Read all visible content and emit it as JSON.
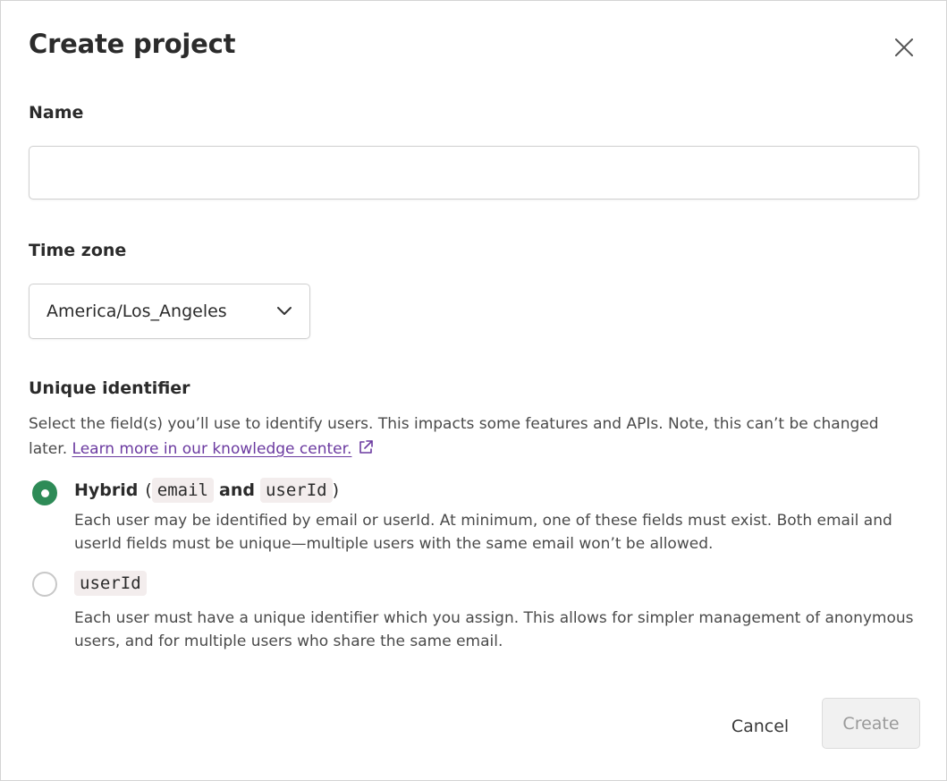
{
  "dialog": {
    "title": "Create project",
    "close_icon": "close-icon"
  },
  "name_field": {
    "label": "Name",
    "value": ""
  },
  "timezone": {
    "label": "Time zone",
    "selected": "America/Los_Angeles",
    "icon": "chevron-down-icon"
  },
  "unique_identifier": {
    "label": "Unique identifier",
    "description": "Select the field(s) you’ll use to identify users. This impacts some features and APIs. Note, this can’t be changed later.",
    "link_text": "Learn more in our knowledge center.",
    "link_icon": "external-link-icon",
    "options": [
      {
        "checked": true,
        "title_prefix": "Hybrid",
        "open_paren": "(",
        "code_1": "email",
        "connector": "and",
        "code_2": "userId",
        "close_paren": ")",
        "description": "Each user may be identified by email or userId. At minimum, one of these fields must exist. Both email and userId fields must be unique—multiple users with the same email won’t be allowed."
      },
      {
        "checked": false,
        "code": "userId",
        "description": "Each user must have a unique identifier which you assign. This allows for simpler management of anonymous users, and for multiple users who share the same email."
      }
    ]
  },
  "footer": {
    "cancel_label": "Cancel",
    "create_label": "Create"
  },
  "colors": {
    "accent_green": "#2e8b57",
    "link_purple": "#6b3aa0",
    "code_bg": "#f3eded"
  }
}
